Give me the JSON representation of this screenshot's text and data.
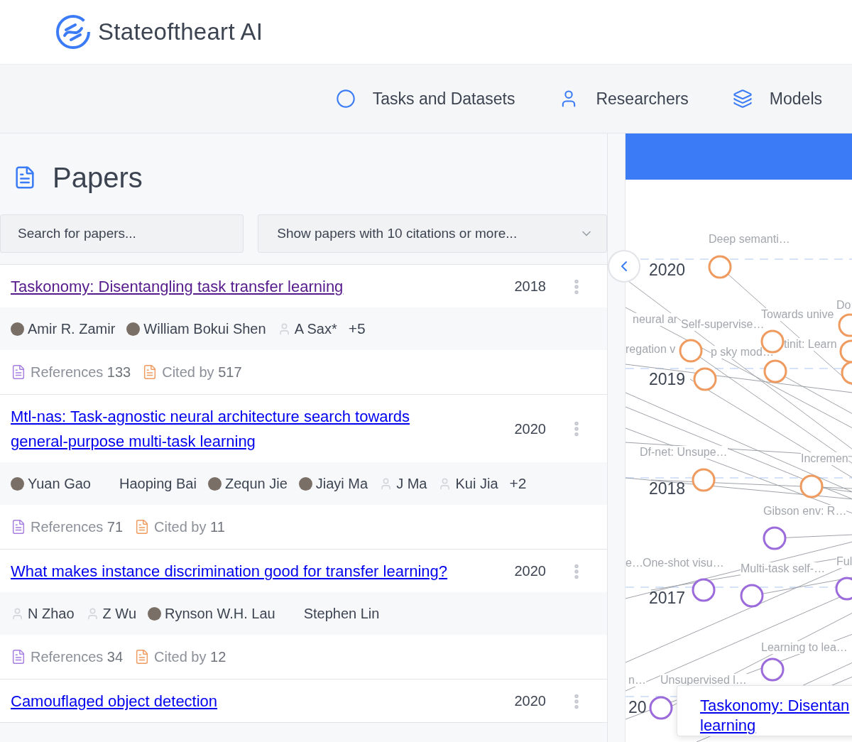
{
  "brand": {
    "name": "Stateoftheart AI"
  },
  "nav": [
    {
      "label": "Tasks and Datasets",
      "kind": "circle"
    },
    {
      "label": "Researchers",
      "kind": "user"
    },
    {
      "label": "Models",
      "kind": "layers"
    }
  ],
  "papers": {
    "title": "Papers",
    "search": {
      "placeholder": "Search for papers..."
    },
    "filter": {
      "value": "Show papers with 10 citations or more..."
    },
    "items": [
      {
        "title": "Taskonomy: Disentangling task transfer learning",
        "visited": true,
        "year": "2018",
        "authors": [
          {
            "name": "Amir R. Zamir",
            "kind": "photo"
          },
          {
            "name": "William Bokui Shen",
            "kind": "photo"
          },
          {
            "name": "A Sax*",
            "kind": "generic"
          }
        ],
        "more_authors": "+5",
        "references_label": "References",
        "references": "133",
        "cited_label": "Cited by",
        "cited": "517"
      },
      {
        "title": "Mtl-nas: Task-agnostic neural architecture search towards general-purpose multi-task learning",
        "visited": false,
        "year": "2020",
        "authors": [
          {
            "name": "Yuan Gao",
            "kind": "photo"
          },
          {
            "name": "Haoping Bai",
            "kind": "plain"
          },
          {
            "name": "Zequn Jie",
            "kind": "photo"
          },
          {
            "name": "Jiayi Ma",
            "kind": "photo"
          },
          {
            "name": "J Ma",
            "kind": "generic"
          },
          {
            "name": "Kui Jia",
            "kind": "generic"
          }
        ],
        "more_authors": "+2",
        "references_label": "References",
        "references": "71",
        "cited_label": "Cited by",
        "cited": "11"
      },
      {
        "title": "What makes instance discrimination good for transfer learning?",
        "visited": false,
        "year": "2020",
        "authors": [
          {
            "name": "N Zhao",
            "kind": "generic"
          },
          {
            "name": "Z Wu",
            "kind": "generic"
          },
          {
            "name": "Rynson W.H. Lau",
            "kind": "photo"
          },
          {
            "name": "Stephen Lin",
            "kind": "plain"
          }
        ],
        "references_label": "References",
        "references": "34",
        "cited_label": "Cited by",
        "cited": "12"
      },
      {
        "title": "Camouflaged object detection",
        "visited": false,
        "year": "2020"
      }
    ]
  },
  "graph": {
    "years": [
      "2020",
      "2019",
      "2018",
      "2017",
      "20"
    ],
    "nodes": [
      {
        "label": "Deep semanti…",
        "color": "#ef9a5e"
      },
      {
        "label": "Do",
        "color": "#ef9a5e"
      },
      {
        "label": "Towards unive",
        "color": "#ef9a5e"
      },
      {
        "label": "Self-supervise…",
        "color": "#ef9a5e"
      },
      {
        "label": "p sky mod…",
        "color": "#ef9a5e"
      },
      {
        "label": "tinit: Learn",
        "color": "#ef9a5e"
      },
      {
        "label": "Df-net: Unsupe…",
        "color": "#ef9a5e"
      },
      {
        "label": "Incremen",
        "color": "#ef9a5e"
      },
      {
        "label": "Gibson env: R…",
        "color": "#9b6bdc"
      },
      {
        "label": "One-shot visu…",
        "color": "#9b6bdc"
      },
      {
        "label": "Multi-task self-…",
        "color": "#9b6bdc"
      },
      {
        "label": "Ful",
        "color": "#9b6bdc"
      },
      {
        "label": "Unsupervised l…",
        "color": "#9b6bdc"
      },
      {
        "label": "Learning to lea…",
        "color": "#9b6bdc"
      }
    ],
    "other_labels": [
      "neural ar",
      "regation v",
      "e…",
      "n…"
    ],
    "popup": {
      "title": "Taskonomy: Disentan learning"
    }
  }
}
